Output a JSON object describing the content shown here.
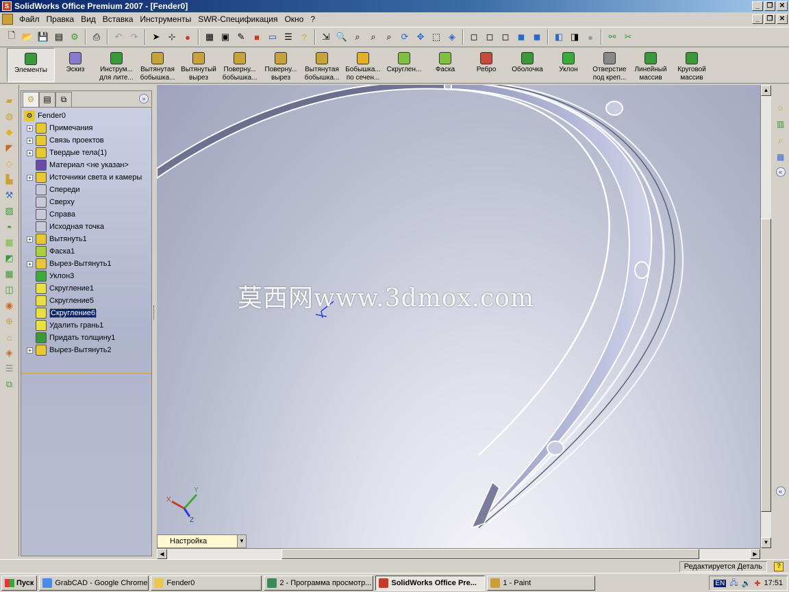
{
  "window": {
    "title": "SolidWorks Office Premium 2007 - [Fender0]"
  },
  "menu": [
    "Файл",
    "Правка",
    "Вид",
    "Вставка",
    "Инструменты",
    "SWR-Спецификация",
    "Окно",
    "?"
  ],
  "command_manager": {
    "items": [
      {
        "label1": "Элементы",
        "label2": "",
        "icon": "features-icon",
        "color": "#3a9a3a"
      },
      {
        "label1": "Эскиз",
        "label2": "",
        "icon": "sketch-icon",
        "color": "#8a7acc"
      },
      {
        "label1": "Инструм...",
        "label2": "для лите...",
        "icon": "mold-tools-icon",
        "color": "#3a9a3a"
      },
      {
        "label1": "Вытянутая",
        "label2": "бобышка...",
        "icon": "extruded-boss-icon",
        "color": "#c9a23a"
      },
      {
        "label1": "Вытянутый",
        "label2": "вырез",
        "icon": "extruded-cut-icon",
        "color": "#c9a23a"
      },
      {
        "label1": "Поверну...",
        "label2": "бобышка...",
        "icon": "revolved-boss-icon",
        "color": "#c9a23a"
      },
      {
        "label1": "Поверну...",
        "label2": "вырез",
        "icon": "revolved-cut-icon",
        "color": "#c9a23a"
      },
      {
        "label1": "Вытянутая",
        "label2": "бобышка...",
        "icon": "swept-boss-icon",
        "color": "#c9a23a"
      },
      {
        "label1": "Бобышка...",
        "label2": "по сечен...",
        "icon": "loft-boss-icon",
        "color": "#e3b028"
      },
      {
        "label1": "Скруглен...",
        "label2": "",
        "icon": "fillet-icon",
        "color": "#7fc040"
      },
      {
        "label1": "Фаска",
        "label2": "",
        "icon": "chamfer-icon",
        "color": "#7fc040"
      },
      {
        "label1": "Ребро",
        "label2": "",
        "icon": "rib-icon",
        "color": "#c94a3a"
      },
      {
        "label1": "Оболочка",
        "label2": "",
        "icon": "shell-icon",
        "color": "#3a9a3a"
      },
      {
        "label1": "Уклон",
        "label2": "",
        "icon": "draft-icon",
        "color": "#3aaa3a"
      },
      {
        "label1": "Отверстие",
        "label2": "под креп...",
        "icon": "hole-wizard-icon",
        "color": "#888888"
      },
      {
        "label1": "Линейный",
        "label2": "массив",
        "icon": "linear-pattern-icon",
        "color": "#3a9a3a"
      },
      {
        "label1": "Круговой",
        "label2": "массив",
        "icon": "circular-pattern-icon",
        "color": "#3a9a3a"
      }
    ]
  },
  "feature_tree": {
    "root": "Fender0",
    "items": [
      {
        "label": "Примечания",
        "expand": true,
        "icon": "annotations-icon",
        "color": "#e8c830"
      },
      {
        "label": "Связь проектов",
        "expand": true,
        "icon": "design-binder-icon",
        "color": "#e8c830"
      },
      {
        "label": "Твердые тела(1)",
        "expand": true,
        "icon": "solid-bodies-icon",
        "color": "#e8c830"
      },
      {
        "label": "Материал <не указан>",
        "expand": false,
        "icon": "material-icon",
        "color": "#6a4aaa"
      },
      {
        "label": "Источники света и камеры",
        "expand": true,
        "icon": "lights-icon",
        "color": "#e8c830"
      },
      {
        "label": "Спереди",
        "expand": false,
        "icon": "front-plane-icon",
        "color": "#c8c8d8"
      },
      {
        "label": "Сверху",
        "expand": false,
        "icon": "top-plane-icon",
        "color": "#c8c8d8"
      },
      {
        "label": "Справа",
        "expand": false,
        "icon": "right-plane-icon",
        "color": "#c8c8d8"
      },
      {
        "label": "Исходная точка",
        "expand": false,
        "icon": "origin-icon",
        "color": "#c8c8d8"
      },
      {
        "label": "Вытянуть1",
        "expand": true,
        "icon": "extrude-icon",
        "color": "#e8c830"
      },
      {
        "label": "Фаска1",
        "expand": false,
        "icon": "chamfer-feature-icon",
        "color": "#a8d040"
      },
      {
        "label": "Вырез-Вытянуть1",
        "expand": true,
        "icon": "cut-extrude-icon",
        "color": "#e8c830"
      },
      {
        "label": "Уклон3",
        "expand": false,
        "icon": "draft-feature-icon",
        "color": "#3aaa3a"
      },
      {
        "label": "Скругление1",
        "expand": false,
        "icon": "fillet-feature-icon",
        "color": "#e8e040"
      },
      {
        "label": "Скругление5",
        "expand": false,
        "icon": "fillet-feature-icon",
        "color": "#e8e040"
      },
      {
        "label": "Скругление6",
        "expand": false,
        "icon": "fillet-feature-icon",
        "color": "#e8e040",
        "selected": true
      },
      {
        "label": "Удалить грань1",
        "expand": false,
        "icon": "delete-face-icon",
        "color": "#e8e040"
      },
      {
        "label": "Придать толщину1",
        "expand": false,
        "icon": "thicken-icon",
        "color": "#3a9a3a"
      },
      {
        "label": "Вырез-Вытянуть2",
        "expand": true,
        "icon": "cut-extrude-icon",
        "color": "#e8c830"
      }
    ]
  },
  "viewport": {
    "watermark": "莫西网www.3dmox.com",
    "configuration": "Настройка",
    "triad": {
      "x": "X",
      "y": "Y",
      "z": "Z"
    }
  },
  "status": {
    "text": "Редактируется Деталь",
    "help": "?"
  },
  "taskbar": {
    "start": "Пуск",
    "buttons": [
      {
        "label": "GrabCAD - Google Chrome",
        "icon": "chrome-icon",
        "color": "#4a8ae8",
        "width": 160
      },
      {
        "label": "Fender0",
        "icon": "folder-icon",
        "color": "#e8c850",
        "width": 162
      },
      {
        "label": "2 - Программа просмотр...",
        "icon": "image-viewer-icon",
        "color": "#3a8a5a",
        "width": 160
      },
      {
        "label": "SolidWorks Office Pre...",
        "icon": "solidworks-icon",
        "color": "#c83a2a",
        "width": 160,
        "active": true
      },
      {
        "label": "1 - Paint",
        "icon": "paint-icon",
        "color": "#c8a03a",
        "width": 158
      }
    ],
    "lang": "EN",
    "clock": "17:51"
  }
}
